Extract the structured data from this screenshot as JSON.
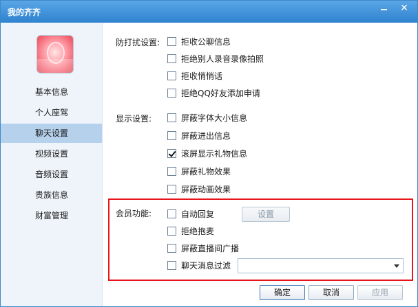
{
  "window": {
    "title": "我的齐齐",
    "minimize_icon": "minimize-icon",
    "close_icon": "close-icon"
  },
  "sidebar": {
    "avatar_icon": "user-avatar-image",
    "items": [
      {
        "label": "基本信息",
        "active": false
      },
      {
        "label": "个人座驾",
        "active": false
      },
      {
        "label": "聊天设置",
        "active": true
      },
      {
        "label": "视频设置",
        "active": false
      },
      {
        "label": "音频设置",
        "active": false
      },
      {
        "label": "贵族信息",
        "active": false
      },
      {
        "label": "财富管理",
        "active": false
      }
    ]
  },
  "anti_disturb": {
    "label": "防打扰设置:",
    "options": [
      {
        "label": "拒收公聊信息",
        "checked": false
      },
      {
        "label": "拒绝别人录音录像拍照",
        "checked": false
      },
      {
        "label": "拒收悄悄话",
        "checked": false
      },
      {
        "label": "拒绝QQ好友添加申请",
        "checked": false
      }
    ]
  },
  "display": {
    "label": "显示设置:",
    "options": [
      {
        "label": "屏蔽字体大小信息",
        "checked": false
      },
      {
        "label": "屏蔽进出信息",
        "checked": false
      },
      {
        "label": "滚屏显示礼物信息",
        "checked": true
      },
      {
        "label": "屏蔽礼物效果",
        "checked": false
      },
      {
        "label": "屏蔽动画效果",
        "checked": false
      }
    ]
  },
  "member": {
    "label": "会员功能:",
    "options": [
      {
        "label": "自动回复",
        "checked": false
      },
      {
        "label": "拒绝抱麦",
        "checked": false
      },
      {
        "label": "屏蔽直播间广播",
        "checked": false
      },
      {
        "label": "聊天消息过滤",
        "checked": false
      }
    ],
    "settings_button": "设置",
    "filter_value": "",
    "highlight_color": "#e8141c"
  },
  "footer": {
    "ok": "确定",
    "cancel": "取消",
    "apply": "应用"
  }
}
